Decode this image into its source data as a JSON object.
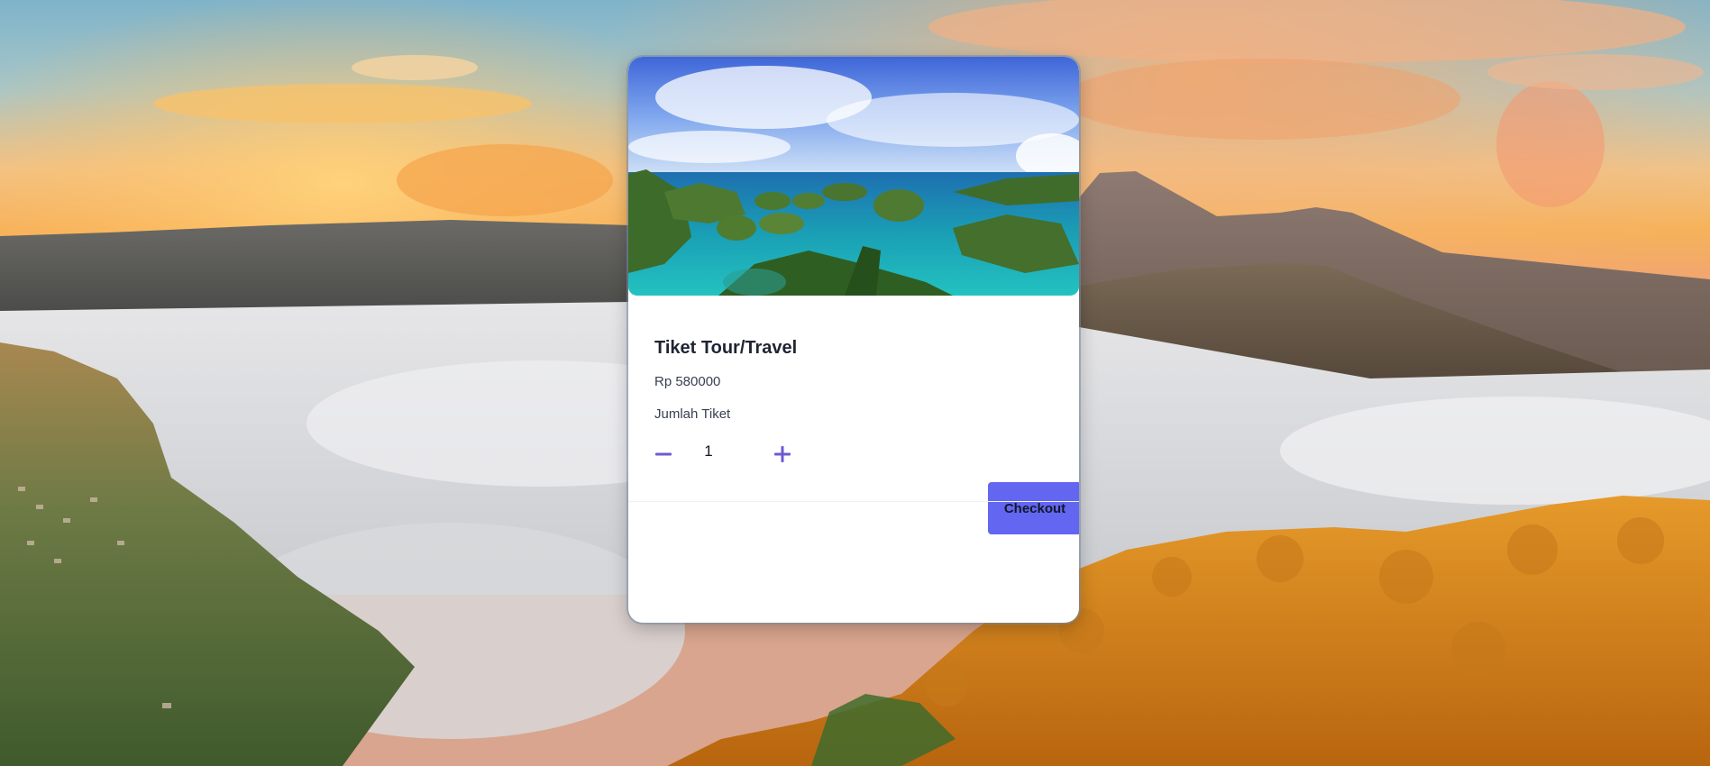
{
  "product": {
    "title": "Tiket Tour/Travel",
    "price": "Rp 580000",
    "quantity_label": "Jumlah Tiket",
    "quantity": "1"
  },
  "actions": {
    "checkout_label": "Checkout"
  },
  "icons": {
    "decrement": "minus-icon",
    "increment": "plus-icon"
  },
  "colors": {
    "accent": "#6366f1",
    "stepper_icon": "#6d5bd0",
    "title_text": "#1f2433"
  }
}
